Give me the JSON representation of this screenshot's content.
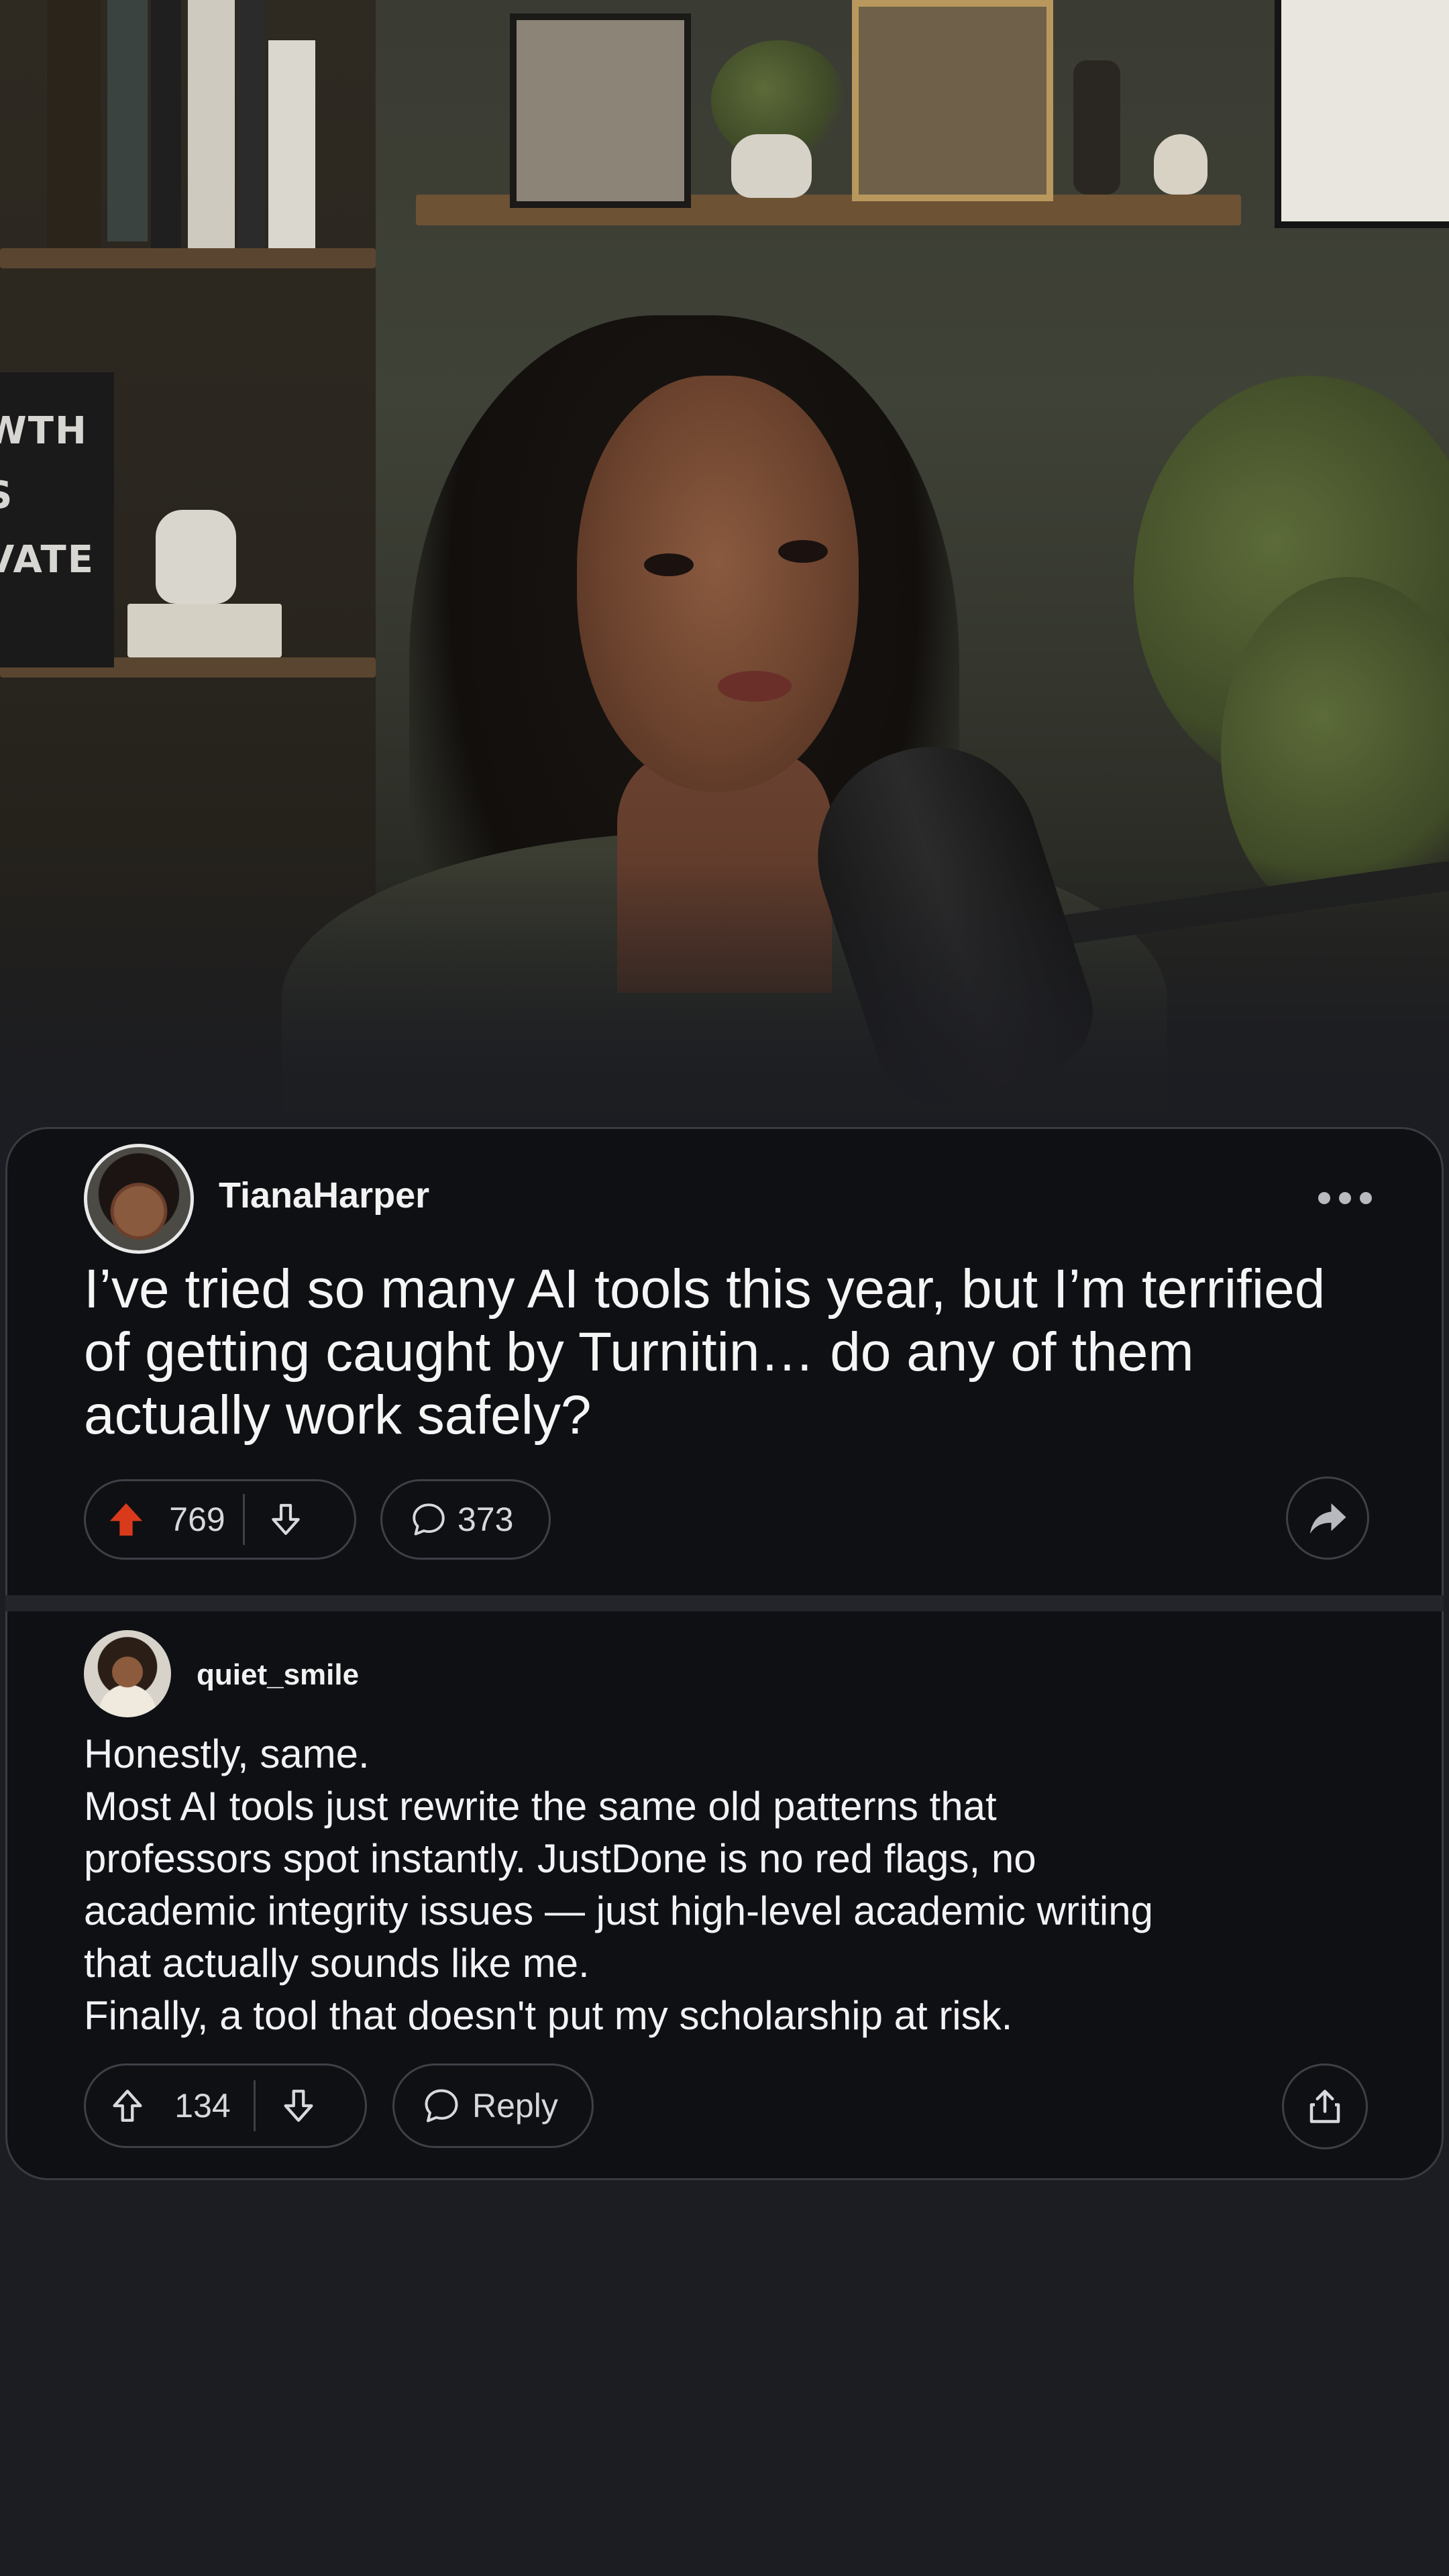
{
  "hero": {
    "sign_lines": [
      "WTH",
      "S",
      "VATE"
    ]
  },
  "post": {
    "username": "TianaHarper",
    "title": "I’ve tried so many AI tools this year, but I’m terrified of getting caught by Turnitin… do any of them actually work safely?",
    "upvotes": "769",
    "comments": "373",
    "upvoted": true,
    "accent_color": "#d93a1c"
  },
  "comment": {
    "username": "quiet_smile",
    "lines": [
      "Honestly, same.",
      "Most AI tools just rewrite the same old patterns that",
      "professors spot instantly. JustDone is no red flags, no",
      "academic integrity issues — just high-level academic writing",
      "that actually sounds like me.",
      "Finally, a tool that doesn't put my scholarship at risk."
    ],
    "upvotes": "134",
    "reply_label": "Reply"
  },
  "icons": {
    "more": "more-dots-icon",
    "upvote": "arrow-up-icon",
    "downvote": "arrow-down-icon",
    "comment": "speech-bubble-icon",
    "share_post": "share-arrow-icon",
    "share_comment": "share-box-icon"
  },
  "colors": {
    "background": "#1c1d22",
    "card": "#0f1014",
    "border": "#3f4047",
    "text": "#f2f2f3"
  }
}
